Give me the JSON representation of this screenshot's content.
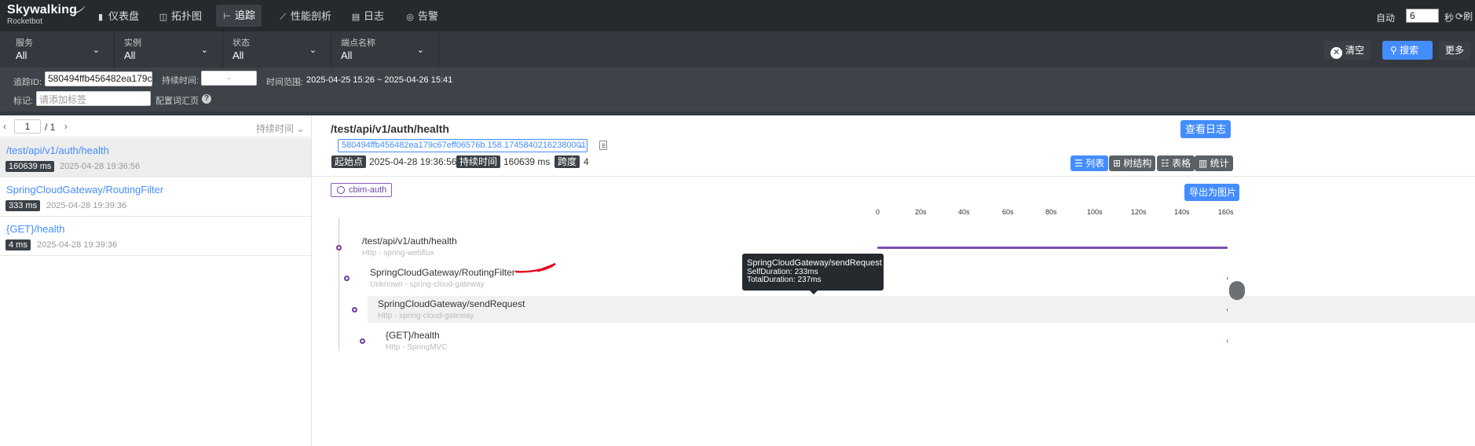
{
  "app": {
    "logo": "Skywalking",
    "logo_sub": "Rocketbot"
  },
  "nav": [
    {
      "label": "仪表盘",
      "icon": "dashboard-icon",
      "glyph": "▮"
    },
    {
      "label": "拓扑图",
      "icon": "topology-icon",
      "glyph": "◫"
    },
    {
      "label": "追踪",
      "icon": "trace-icon",
      "glyph": "⊢"
    },
    {
      "label": "性能剖析",
      "icon": "profile-icon",
      "glyph": "⟋"
    },
    {
      "label": "日志",
      "icon": "log-icon",
      "glyph": "▤"
    },
    {
      "label": "告警",
      "icon": "alarm-icon",
      "glyph": "◎"
    }
  ],
  "auto_refresh": {
    "label": "自动",
    "value": "6",
    "unit": "秒",
    "refresh": "刷"
  },
  "filters": {
    "service": {
      "label": "服务",
      "value": "All"
    },
    "instance": {
      "label": "实例",
      "value": "All"
    },
    "status": {
      "label": "状态",
      "value": "All"
    },
    "endpoint": {
      "label": "端点名称",
      "value": "All"
    },
    "clear": "清空",
    "search": "搜索",
    "more": "更多"
  },
  "filters2": {
    "trace_id_label": "追踪ID:",
    "trace_id_value": "580494ffb456482ea179c",
    "duration_label": "持续时间:",
    "duration_value": "-",
    "time_range_label": "时间范围:",
    "time_range_value": "2025-04-25 15:26 ~ 2025-04-26 15:41",
    "tags_label": "标记:",
    "tags_placeholder": "请添加标签",
    "config_link": "配置词汇页",
    "help": "?"
  },
  "pager": {
    "page": "1",
    "total": "/ 1",
    "sort": "持续时间"
  },
  "traces": [
    {
      "name": "/test/api/v1/auth/health",
      "duration": "160639 ms",
      "time": "2025-04-28 19:36:56"
    },
    {
      "name": "SpringCloudGateway/RoutingFilter",
      "duration": "333 ms",
      "time": "2025-04-28 19:39:36"
    },
    {
      "name": "{GET}/health",
      "duration": "4 ms",
      "time": "2025-04-28 19:39:36"
    }
  ],
  "detail": {
    "title": "/test/api/v1/auth/health",
    "trace_id": "580494ffb456482ea179c67eff06576b.158.17458402162380001",
    "start_label": "起始点",
    "start_value": "2025-04-28 19:36:56",
    "duration_label": "持续时间",
    "duration_value": "160639 ms",
    "span_label": "跨度",
    "span_value": "4",
    "view_log": "查看日志",
    "views": [
      "列表",
      "树结构",
      "表格",
      "统计"
    ],
    "service_tag": "cbim-auth",
    "export": "导出为图片",
    "axis_ticks": [
      "0",
      "20s",
      "40s",
      "60s",
      "80s",
      "100s",
      "120s",
      "140s",
      "160s"
    ],
    "spans": [
      {
        "name": "/test/api/v1/auth/health",
        "sub": "Http - spring-webflux",
        "duration_ms": 160639
      },
      {
        "name": "SpringCloudGateway/RoutingFilter",
        "sub": "Unknown - spring-cloud-gateway",
        "duration_ms": 0
      },
      {
        "name": "SpringCloudGateway/sendRequest",
        "sub": "Http - spring-cloud-gateway",
        "duration_ms": 237
      },
      {
        "name": "{GET}/health",
        "sub": "Http - SpringMVC",
        "duration_ms": 4
      }
    ],
    "tooltip": {
      "title": "SpringCloudGateway/sendRequest",
      "self": "SelfDuration: 233ms",
      "total": "TotalDuration: 237ms"
    }
  },
  "colors": {
    "accent": "#448dfe",
    "span": "#7c4db3",
    "nav_bg": "#252a2f"
  }
}
